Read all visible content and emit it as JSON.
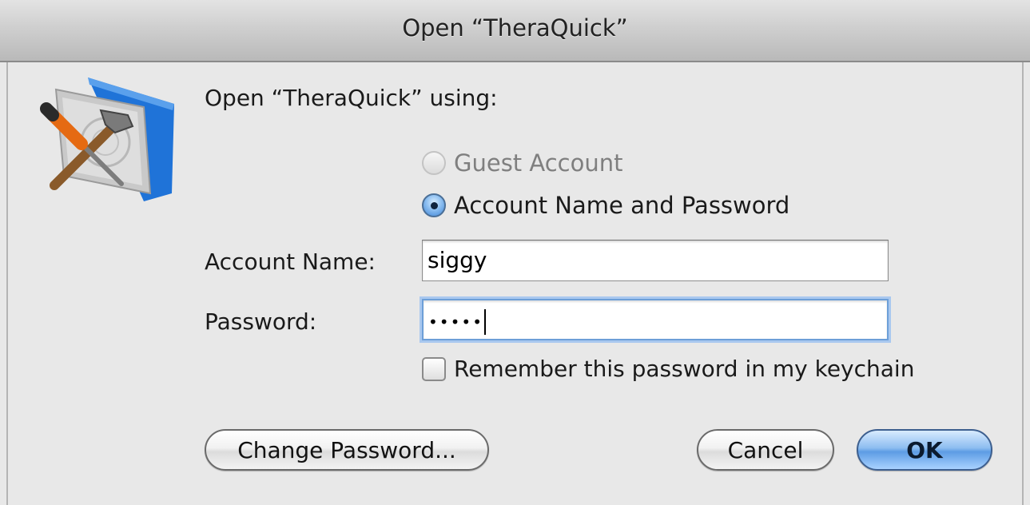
{
  "window": {
    "title": "Open “TheraQuick”"
  },
  "dialog": {
    "heading": "Open “TheraQuick” using:",
    "radio_options": [
      {
        "label": "Guest Account",
        "selected": false,
        "enabled": false
      },
      {
        "label": "Account Name and Password",
        "selected": true,
        "enabled": true
      }
    ],
    "account_name": {
      "label": "Account Name:",
      "value": "siggy"
    },
    "password": {
      "label": "Password:",
      "masked_value": "•••••"
    },
    "remember": {
      "label": "Remember this password in my keychain",
      "checked": false
    }
  },
  "buttons": {
    "change_password": "Change Password...",
    "cancel": "Cancel",
    "ok": "OK"
  },
  "icons": {
    "app_icon": "folder-with-tools-icon"
  },
  "colors": {
    "default_button": "#5d9ce4",
    "focus_ring": "#a9c8ef"
  }
}
